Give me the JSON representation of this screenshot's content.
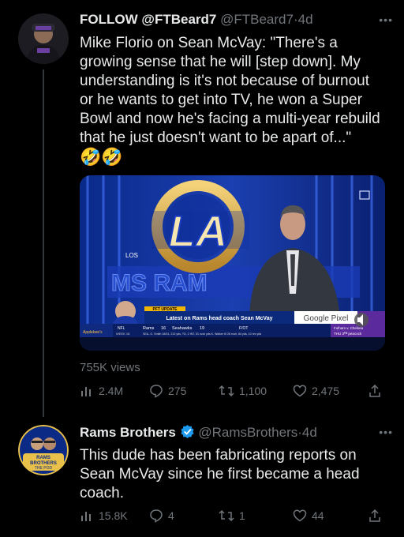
{
  "tweet1": {
    "display_name": "FOLLOW @FTBeard7",
    "handle": "@FTBeard7",
    "separator": "·",
    "time": "4d",
    "text_lines": [
      "Mike Florio on Sean McVay: \"There's a",
      "growing sense that he will [step down]. My",
      "understanding is it's not because of burnout",
      "or he wants to get into TV, he won a Super",
      "Bowl and now he's facing a multi-year rebuild",
      "that he just doesn't want to be apart of...\""
    ],
    "emojis": "🤣🤣",
    "media": {
      "logo_letters": "LA",
      "logo_sub": "LOS",
      "ticker_small": "PFT UPDATE",
      "ticker_headline": "Latest on Rams head coach Sean McVay",
      "score_league": "NFL",
      "score_week": "WEEK 18",
      "score_team1": "Rams",
      "score_val1": "16",
      "score_team2": "Seahawks",
      "score_val2": "19",
      "score_status": "F/OT",
      "score_detail": "SEA- G. Smith 18/31, 213 yds, TD, 2 INT, 51 rush yds   K. Walker III 26 rush, 84 yds, 10 rec yds",
      "sponsor_text": "Google Pixel",
      "side_text": "Fulham v. Chelsea",
      "side_sub": "THU 3ᴾᴹ peacock",
      "banner_text": "MS RAM"
    },
    "views": "755K views",
    "stats": {
      "views": "2.4M",
      "replies": "275",
      "retweets": "1,100",
      "likes": "2,475"
    }
  },
  "tweet2": {
    "display_name": "Rams Brothers",
    "handle": "@RamsBrothers",
    "separator": "·",
    "time": "4d",
    "avatar_text_1": "RAMS",
    "avatar_text_2": "BROTHERS",
    "avatar_text_3": "THE POD",
    "text_lines": [
      "This dude has been fabricating reports on",
      "Sean McVay since he first became a head",
      "coach."
    ],
    "stats": {
      "views": "15.8K",
      "replies": "4",
      "retweets": "1",
      "likes": "44"
    }
  },
  "colors": {
    "background": "#000000",
    "text": "#e7e9ea",
    "muted": "#71767b",
    "verified": "#1d9bf0"
  }
}
